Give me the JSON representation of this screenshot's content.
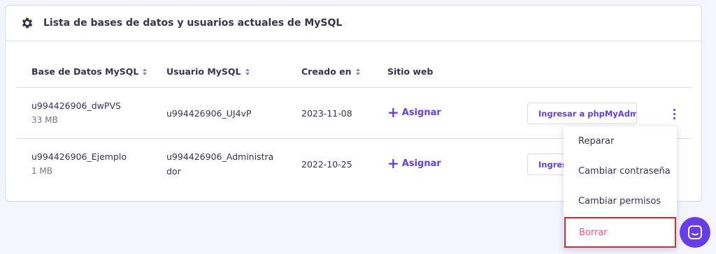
{
  "panel": {
    "title": "Lista de bases de datos y usuarios actuales de MySQL",
    "icon": "gear-icon"
  },
  "table": {
    "headers": [
      "Base de Datos MySQL",
      "Usuario MySQL",
      "Creado en",
      "Sitio web"
    ],
    "rows": [
      {
        "db_name": "u994426906_dwPVS",
        "db_size": "33 MB",
        "user_line1": "u994426906_UJ4vP",
        "user_line2": "",
        "created": "2023-11-08",
        "website_action": "Asignar",
        "button": "Ingresar a phpMyAdmin"
      },
      {
        "db_name": "u994426906_Ejemplo",
        "db_size": "1 MB",
        "user_line1": "u994426906_Administra",
        "user_line2": "dor",
        "created": "2022-10-25",
        "website_action": "Asignar",
        "button": "Ingresar a phpMyAdmin"
      }
    ]
  },
  "dropdown": {
    "items": [
      "Reparar",
      "Cambiar contraseña",
      "Cambiar permisos",
      "Borrar"
    ]
  },
  "colors": {
    "accent": "#673de6",
    "danger_text": "#fc5185",
    "highlight_border": "#e4242a"
  },
  "chat": {
    "icon": "chat-icon"
  }
}
